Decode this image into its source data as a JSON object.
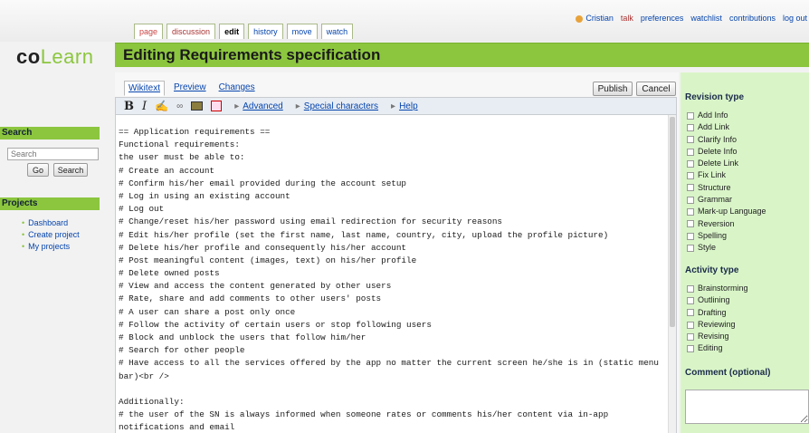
{
  "top": {
    "tabs": [
      {
        "label": "page",
        "style": "plain"
      },
      {
        "label": "discussion",
        "style": "talk"
      },
      {
        "label": "edit",
        "style": "sel"
      },
      {
        "label": "history",
        "style": "link"
      },
      {
        "label": "move",
        "style": "link"
      },
      {
        "label": "watch",
        "style": "link"
      }
    ],
    "user": "Cristian",
    "links": [
      "talk",
      "preferences",
      "watchlist",
      "contributions",
      "log out"
    ]
  },
  "logo": {
    "co": "co",
    "learn": "Learn"
  },
  "sidebar": {
    "search_heading": "Search",
    "search_placeholder": "Search",
    "go_label": "Go",
    "search_label": "Search",
    "projects_heading": "Projects",
    "projects": [
      "Dashboard",
      "Create project",
      "My projects"
    ]
  },
  "page_title": "Editing Requirements specification",
  "editor": {
    "tabs": [
      "Wikitext",
      "Preview",
      "Changes"
    ],
    "publish_label": "Publish",
    "cancel_label": "Cancel",
    "toolbar_menus": [
      "Advanced",
      "Special characters",
      "Help"
    ],
    "lines": [
      "== Application requirements ==",
      "Functional requirements:",
      "the user must be able to:",
      "# Create an account",
      "# Confirm his/her email provided during the account setup",
      "# Log in using an existing account",
      "# Log out",
      "# Change/reset his/her password using email redirection for security reasons",
      "# Edit his/her profile (set the first name, last name, country, city, upload the profile picture)",
      "# Delete his/her profile and consequently his/her account",
      "# Post meaningful content (images, text) on his/her profile",
      "# Delete owned posts",
      "# View and access the content generated by other users",
      "# Rate, share and add comments to other users' posts",
      "# A user can share a post only once",
      "# Follow the activity of certain users or stop following users",
      "# Block and unblock the users that follow him/her",
      "# Search for other people",
      "# Have access to all the services offered by the app no matter the current screen he/she is in (static menu",
      "bar)<br />",
      "",
      "Additionally:",
      "# the user of the SN is always informed when someone rates or comments his/her content via in-app",
      "notifications and email"
    ]
  },
  "right": {
    "revision_heading": "Revision type",
    "revision_types": [
      "Add Info",
      "Add Link",
      "Clarify Info",
      "Delete Info",
      "Delete Link",
      "Fix Link",
      "Structure",
      "Grammar",
      "Mark-up Language",
      "Reversion",
      "Spelling",
      "Style"
    ],
    "activity_heading": "Activity type",
    "activity_types": [
      "Brainstorming",
      "Outlining",
      "Drafting",
      "Reviewing",
      "Revising",
      "Editing"
    ],
    "comment_heading": "Comment (optional)"
  }
}
